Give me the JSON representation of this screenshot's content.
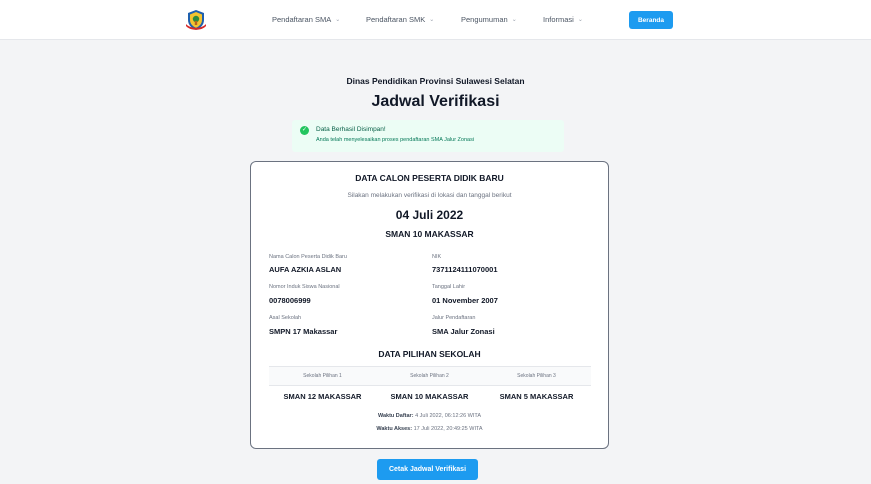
{
  "nav": {
    "items": [
      {
        "label": "Pendaftaran SMA"
      },
      {
        "label": "Pendaftaran SMK"
      },
      {
        "label": "Pengumuman"
      },
      {
        "label": "Informasi"
      }
    ],
    "home_label": "Beranda"
  },
  "header": {
    "agency": "Dinas Pendidikan Provinsi Sulawesi Selatan",
    "title": "Jadwal Verifikasi"
  },
  "alert": {
    "title": "Data Berhasil Disimpan!",
    "message": "Anda telah menyelesaikan proses pendaftaran SMA Jalur Zonasi"
  },
  "card": {
    "title": "DATA CALON PESERTA DIDIK BARU",
    "subtitle": "Silakan melakukan verifikasi di lokasi dan tanggal berikut",
    "date": "04 Juli 2022",
    "school": "SMAN 10 MAKASSAR",
    "fields": {
      "name_label": "Nama Calon Peserta Didik Baru",
      "name_value": "AUFA AZKIA ASLAN",
      "nik_label": "NIK",
      "nik_value": "7371124111070001",
      "nisn_label": "Nomor Induk Siswa Nasional",
      "nisn_value": "0078006999",
      "dob_label": "Tanggal Lahir",
      "dob_value": "01 November 2007",
      "origin_label": "Asal Sekolah",
      "origin_value": "SMPN 17 Makassar",
      "track_label": "Jalur Pendaftaran",
      "track_value": "SMA Jalur Zonasi"
    },
    "choices_title": "DATA PILIHAN SEKOLAH",
    "choices": [
      {
        "header": "Sekolah Pilihan 1",
        "value": "SMAN 12 MAKASSAR"
      },
      {
        "header": "Sekolah Pilihan 2",
        "value": "SMAN 10 MAKASSAR"
      },
      {
        "header": "Sekolah Pilihan 3",
        "value": "SMAN 5 MAKASSAR"
      }
    ],
    "register_time_label": "Waktu Daftar:",
    "register_time_value": "4 Juli 2022, 06:12:26 WITA",
    "access_time_label": "Waktu Akses:",
    "access_time_value": "17 Juli 2022, 20:49:25 WITA"
  },
  "print_label": "Cetak Jadwal Verifikasi",
  "icons": {
    "logo": "provincial-emblem-icon",
    "chevron": "chevron-down-icon",
    "success": "check-circle-icon"
  },
  "colors": {
    "accent": "#1d9bf0",
    "success_bg": "#ecfdf5",
    "success_icon": "#22c55e"
  }
}
